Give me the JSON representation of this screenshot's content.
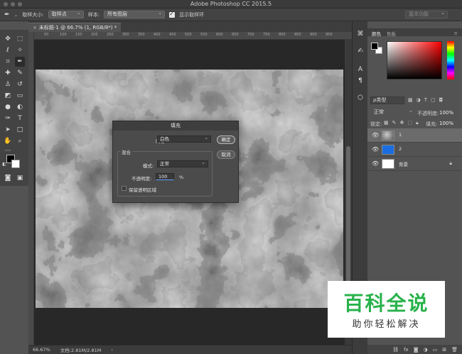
{
  "window": {
    "title": "Adobe Photoshop CC 2015.5"
  },
  "options_bar": {
    "sample_size_label": "取样大小:",
    "sample_size_value": "取样点",
    "sample_label": "样本:",
    "sample_value": "所有图层",
    "show_ring_label": "显示取样环",
    "workspace_value": "基本功能"
  },
  "document": {
    "tab_label": "未标题-1 @ 66.7% (1, RGB/8*) *",
    "ruler_ticks": [
      "50",
      "100",
      "150",
      "200",
      "250",
      "300",
      "350",
      "400",
      "450",
      "500",
      "550",
      "600",
      "650",
      "700",
      "750",
      "800",
      "850",
      "900",
      "950"
    ]
  },
  "status": {
    "zoom": "66.67%",
    "doc_size": "文档:2.81M/2.81M"
  },
  "color_panel": {
    "tab_color": "颜色",
    "tab_swatches": "色板"
  },
  "layers_panel": {
    "tab_layers": "图层",
    "tab_channels": "通道",
    "tab_paths": "路径",
    "filter_label": "ρ类型",
    "blend_mode": "正常",
    "opacity_label": "不透明度:",
    "opacity_value": "100%",
    "lock_label": "锁定:",
    "fill_label": "填充:",
    "fill_value": "100%",
    "layers": [
      {
        "name": "1",
        "selected": true,
        "thumb": "clouds"
      },
      {
        "name": "2",
        "selected": false,
        "thumb": "#1a6de0"
      },
      {
        "name": "背景",
        "selected": false,
        "thumb": "#ffffff"
      }
    ]
  },
  "fill_dialog": {
    "title": "填充",
    "content_label": "内容:",
    "content_value": "白色",
    "ok_label": "确定",
    "cancel_label": "取消",
    "blend_group_label": "混合",
    "mode_label": "模式:",
    "mode_value": "正常",
    "opacity_label": "不透明度:",
    "opacity_value": "100",
    "opacity_unit": "%",
    "preserve_label": "保留透明区域"
  },
  "watermark": {
    "title": "百科全说",
    "subtitle": "助你轻松解决"
  },
  "colors": {
    "foreground": "#000000",
    "background": "#ffffff",
    "layer2_color": "#1a6de0",
    "watermark_green": "#28b24b"
  }
}
